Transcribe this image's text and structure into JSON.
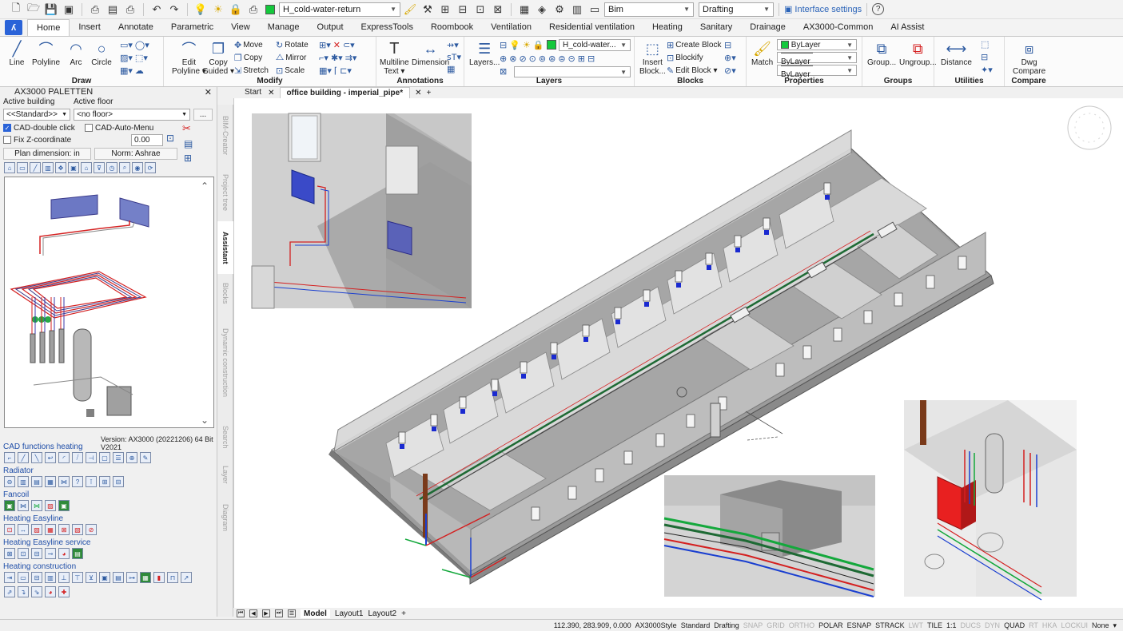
{
  "toolbar": {
    "layer_value": "H_cold-water-return",
    "workspace_value": "Bim",
    "style_value": "Drafting",
    "interface_settings": "Interface settings",
    "help": "?"
  },
  "tabs": [
    "Home",
    "Insert",
    "Annotate",
    "Parametric",
    "View",
    "Manage",
    "Output",
    "ExpressTools",
    "Roombook",
    "Ventilation",
    "Residential ventilation",
    "Heating",
    "Sanitary",
    "Drainage",
    "AX3000-Common",
    "AI Assist"
  ],
  "active_tab": "Home",
  "ribbon": {
    "draw": {
      "title": "Draw",
      "line": "Line",
      "polyline": "Polyline",
      "arc": "Arc",
      "circle": "Circle"
    },
    "modify": {
      "title": "Modify",
      "edit_polyline_1": "Edit",
      "edit_polyline_2": "Polyline ▾",
      "copy_guided_1": "Copy",
      "copy_guided_2": "Guided ▾",
      "move": "Move",
      "copy": "Copy",
      "stretch": "Stretch",
      "rotate": "Rotate",
      "mirror": "Mirror",
      "scale": "Scale"
    },
    "annotations": {
      "title": "Annotations",
      "multiline_1": "Multiline",
      "multiline_2": "Text ▾",
      "dimension": "Dimension"
    },
    "layers": {
      "title": "Layers",
      "layers_btn": "Layers...",
      "layer_combo": "H_cold-water..."
    },
    "blocks": {
      "title": "Blocks",
      "insert_1": "Insert",
      "insert_2": "Block...",
      "create_block": "Create Block",
      "blockify": "Blockify",
      "edit_block": "Edit Block ▾"
    },
    "properties": {
      "title": "Properties",
      "match": "Match",
      "color": "ByLayer",
      "linetype": "ByLayer",
      "lineweight": "ByLayer"
    },
    "groups": {
      "title": "Groups",
      "group": "Group...",
      "ungroup": "Ungroup..."
    },
    "utilities": {
      "title": "Utilities",
      "distance": "Distance"
    },
    "compare": {
      "title": "Compare",
      "dwg_1": "Dwg",
      "dwg_2": "Compare"
    }
  },
  "palette": {
    "title": "AX3000 PALETTEN",
    "active_building_label": "Active building",
    "active_floor_label": "Active floor",
    "building_value": "<<Standard>>",
    "floor_value": "<no floor>",
    "dots": "...",
    "cad_double_click": "CAD-double click",
    "cad_auto_menu": "CAD-Auto-Menu",
    "fix_z": "Fix Z-coordinate",
    "z_value": "0.00",
    "plan_dimension": "Plan dimension: in",
    "norm": "Norm: Ashrae",
    "version": "Version: AX3000 (20221206) 64 Bit V2021",
    "sections": [
      "CAD functions heating",
      "Radiator",
      "Fancoil",
      "Heating Easyline",
      "Heating Easyline service",
      "Heating construction"
    ]
  },
  "side_tabs": [
    "BIM-Creator",
    "Project tree",
    "Assistant",
    "Blocks",
    "Dynamic construction",
    "Search",
    "Layer",
    "Diagram"
  ],
  "doc_tabs": {
    "start": "Start",
    "file": "office building - imperial_pipe*",
    "plus": "+"
  },
  "layout_tabs": [
    "Model",
    "Layout1",
    "Layout2",
    "+"
  ],
  "status": {
    "coords": "112.390, 283.909, 0.000",
    "style": "AX3000Style",
    "standard": "Standard",
    "drafting": "Drafting",
    "toggles": [
      {
        "label": "SNAP",
        "on": false
      },
      {
        "label": "GRID",
        "on": false
      },
      {
        "label": "ORTHO",
        "on": false
      },
      {
        "label": "POLAR",
        "on": true
      },
      {
        "label": "ESNAP",
        "on": true
      },
      {
        "label": "STRACK",
        "on": true
      },
      {
        "label": "LWT",
        "on": false
      },
      {
        "label": "TILE",
        "on": true
      },
      {
        "label": "1:1",
        "on": true
      },
      {
        "label": "DUCS",
        "on": false
      },
      {
        "label": "DYN",
        "on": false
      },
      {
        "label": "QUAD",
        "on": true
      },
      {
        "label": "RT",
        "on": false
      },
      {
        "label": "HKA",
        "on": false
      },
      {
        "label": "LOCKUI",
        "on": false
      },
      {
        "label": "None",
        "on": true
      }
    ]
  },
  "colors": {
    "accent": "#2a63d8",
    "pipe_red": "#d42020",
    "pipe_blue": "#1a3fd0",
    "pipe_green": "#14a83c",
    "wall": "#a8a8a8"
  }
}
